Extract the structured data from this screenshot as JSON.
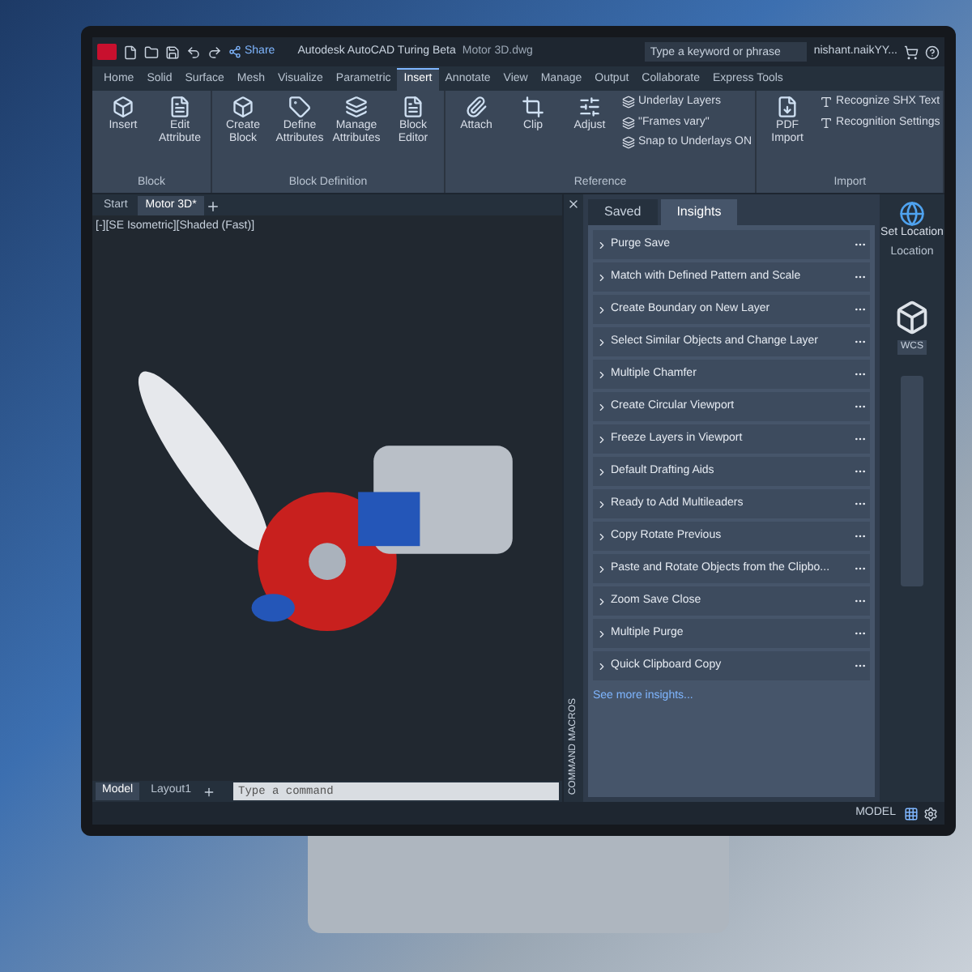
{
  "title_bar": {
    "share": "Share",
    "title": "Autodesk AutoCAD Turing Beta",
    "file": "Motor 3D.dwg",
    "search_placeholder": "Type a keyword or phrase",
    "user": "nishant.naikYY..."
  },
  "ribbon_tabs": [
    {
      "label": "Home",
      "selected": false
    },
    {
      "label": "Solid",
      "selected": false
    },
    {
      "label": "Surface",
      "selected": false
    },
    {
      "label": "Mesh",
      "selected": false
    },
    {
      "label": "Visualize",
      "selected": false
    },
    {
      "label": "Parametric",
      "selected": false
    },
    {
      "label": "Insert",
      "selected": true
    },
    {
      "label": "Annotate",
      "selected": false
    },
    {
      "label": "View",
      "selected": false
    },
    {
      "label": "Manage",
      "selected": false
    },
    {
      "label": "Output",
      "selected": false
    },
    {
      "label": "Collaborate",
      "selected": false
    },
    {
      "label": "Express Tools",
      "selected": false
    }
  ],
  "ribbon_panels": [
    {
      "title": "Block",
      "tools": [
        "Insert",
        "Edit Attribute"
      ]
    },
    {
      "title": "Block Definition",
      "tools": [
        "Create Block",
        "Define Attributes",
        "Manage Attributes",
        "Block Editor"
      ]
    },
    {
      "title": "Reference",
      "tools": [
        "Attach",
        "Clip",
        "Adjust"
      ],
      "options": [
        "Underlay Layers",
        "\"Frames vary\"",
        "Snap to Underlays ON"
      ]
    },
    {
      "title": "Import",
      "tools": [
        "PDF Import"
      ],
      "options": [
        "Recognize SHX Text",
        "Recognition Settings"
      ]
    }
  ],
  "file_tabs": [
    {
      "label": "Start",
      "selected": false
    },
    {
      "label": "Motor 3D*",
      "selected": true
    }
  ],
  "viewport_label": "[-][SE Isometric][Shaded (Fast)]",
  "layout_tabs": [
    {
      "label": "Model",
      "selected": true
    },
    {
      "label": "Layout1",
      "selected": false
    }
  ],
  "command_line": {
    "placeholder": "Type a command"
  },
  "palette": {
    "side_title": "COMMAND MACROS",
    "tabs": [
      {
        "label": "Saved",
        "selected": false
      },
      {
        "label": "Insights",
        "selected": true
      }
    ],
    "items": [
      "Purge Save",
      "Match with Defined Pattern and Scale",
      "Create Boundary on New Layer",
      "Select Similar Objects and Change Layer",
      "Multiple Chamfer",
      "Create Circular Viewport",
      "Freeze Layers in Viewport",
      "Default Drafting Aids",
      "Ready to Add Multileaders",
      "Copy Rotate Previous",
      "Paste and Rotate Objects from the Clipbo...",
      "Zoom Save Close",
      "Multiple Purge",
      "Quick Clipboard Copy"
    ],
    "more_link": "See more insights..."
  },
  "location": {
    "button": "Set Location",
    "panel": "Location"
  },
  "viewcube": {
    "ucs": "WCS"
  },
  "status_bar": {
    "space": "MODEL"
  }
}
